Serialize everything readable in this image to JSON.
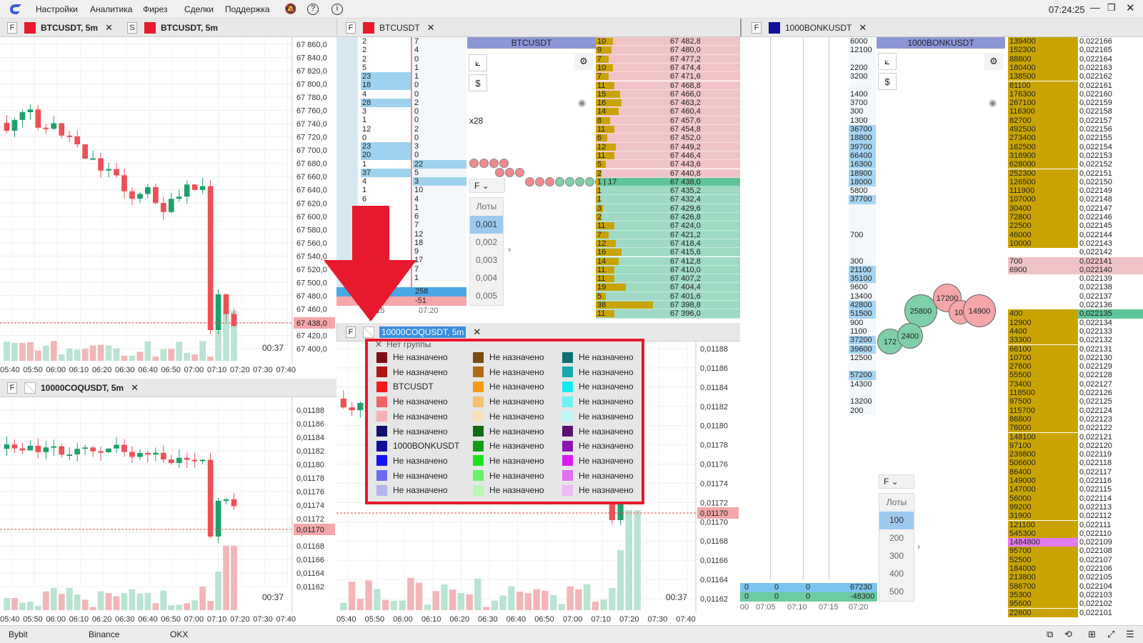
{
  "menu": {
    "items": [
      "Настройки",
      "Аналитика",
      "Фирез",
      "Сделки",
      "Поддержка"
    ],
    "clock": "07:24:25"
  },
  "chart1": {
    "tabs": [
      {
        "prefix": "F",
        "name": "BTCUSDT, 5m",
        "color": "#e8192c"
      },
      {
        "prefix": "S",
        "name": "BTCUSDT, 5m",
        "color": "#e8192c"
      }
    ],
    "y_ticks": [
      "67 860,0",
      "67 840,0",
      "67 820,0",
      "67 800,0",
      "67 780,0",
      "67 760,0",
      "67 740,0",
      "67 720,0",
      "67 700,0",
      "67 680,0",
      "67 660,0",
      "67 640,0",
      "67 620,0",
      "67 600,0",
      "67 580,0",
      "67 560,0",
      "67 540,0",
      "67 520,0",
      "67 500,0",
      "67 480,0",
      "67 460,0",
      "67 440,0",
      "67 420,0",
      "67 400,0"
    ],
    "x_ticks": [
      "05:40",
      "05:50",
      "06:00",
      "06:10",
      "06:20",
      "06:30",
      "06:40",
      "06:50",
      "07:00",
      "07:10",
      "07:20",
      "07:30",
      "07:40"
    ],
    "price_label": "67 438,0",
    "timer": "00:37"
  },
  "chart2": {
    "tab": {
      "prefix": "F",
      "name": "10000COQUSDT, 5m"
    },
    "y_ticks": [
      "0,01188",
      "0,01186",
      "0,01184",
      "0,01182",
      "0,01180",
      "0,01178",
      "0,01176",
      "0,01174",
      "0,01172",
      "0,01170",
      "0,01168",
      "0,01166",
      "0,01164",
      "0,01162"
    ],
    "x_ticks": [
      "05:40",
      "05:50",
      "06:00",
      "06:10",
      "06:20",
      "06:30",
      "06:40",
      "06:50",
      "07:00",
      "07:10",
      "07:20",
      "07:30",
      "07:40"
    ],
    "price_label": "0,01170",
    "timer": "00:37"
  },
  "btc_book": {
    "tab": {
      "prefix": "F",
      "name": "BTCUSDT",
      "color": "#e8192c"
    },
    "header": "BTCUSDT",
    "multiplier": "x28",
    "col1": [
      "2",
      "2",
      "2",
      "5",
      "23",
      "18",
      "4",
      "28",
      "3",
      "1",
      "12",
      "0",
      "23",
      "20",
      "1",
      "37",
      "4",
      "1",
      "6"
    ],
    "col2": [
      "7",
      "4",
      "0",
      "1",
      "1",
      "0",
      "0",
      "2",
      "0",
      "0",
      "2",
      "0",
      "3",
      "0",
      "22",
      "5",
      "3",
      "10",
      "4",
      "1",
      "6",
      "7",
      "12",
      "18",
      "9",
      "17",
      "7",
      "1"
    ],
    "sum_buy": "258",
    "sum_sell": "-51",
    "times": [
      "07:15",
      "07:20"
    ],
    "mode_select": "F",
    "lots_header": "Лоты",
    "lots": [
      "0,001",
      "0,002",
      "0,003",
      "0,004",
      "0,005"
    ],
    "prices": [
      "67 482,8",
      "67 480,0",
      "67 477,2",
      "67 474,4",
      "67 471,6",
      "67 468,8",
      "67 466,0",
      "67 463,2",
      "67 460,4",
      "67 457,6",
      "67 454,8",
      "67 452,0",
      "67 449,2",
      "67 446,4",
      "67 443,6",
      "67 440,8",
      "67 438,0",
      "67 435,2",
      "67 432,4",
      "67 429,6",
      "67 426,8",
      "67 424,0",
      "67 421,2",
      "67 418,4",
      "67 415,6",
      "67 412,8",
      "67 410,0",
      "67 407,2",
      "67 404,4",
      "67 401,6",
      "67 398,8",
      "67 396,0"
    ],
    "volumes": [
      "10",
      "9",
      "7",
      "10",
      "7",
      "11",
      "15",
      "16",
      "14",
      "8",
      "11",
      "6",
      "12",
      "11",
      "5",
      "2",
      "1 | 17",
      "1",
      "1",
      "3",
      "2",
      "11",
      "7",
      "12",
      "16",
      "14",
      "11",
      "11",
      "19",
      "5",
      "38",
      "11"
    ],
    "ask_count": 16
  },
  "coq_legend": {
    "tab": {
      "prefix": "F",
      "name": "10000COQUSDT, 5m"
    },
    "header": "Нет группы",
    "columns": [
      [
        {
          "color": "#7a0f14",
          "label": "Не назначено"
        },
        {
          "color": "#b01616",
          "label": "Не назначено"
        },
        {
          "color": "#f01c1c",
          "label": "BTCUSDT"
        },
        {
          "color": "#f26464",
          "label": "Не назначено"
        },
        {
          "color": "#f4b0b4",
          "label": "Не назначено"
        },
        {
          "color": "#101070",
          "label": "Не назначено"
        },
        {
          "color": "#10109a",
          "label": "1000BONKUSDT"
        },
        {
          "color": "#1414f0",
          "label": "Не назначено"
        },
        {
          "color": "#6b6bf0",
          "label": "Не назначено"
        },
        {
          "color": "#b4b4f0",
          "label": "Не назначено"
        }
      ],
      [
        {
          "color": "#7a4a10",
          "label": "Не назначено"
        },
        {
          "color": "#b06a16",
          "label": "Не назначено"
        },
        {
          "color": "#f59a18",
          "label": "Не назначено"
        },
        {
          "color": "#f6c070",
          "label": "Не назначено"
        },
        {
          "color": "#f8e0b8",
          "label": "Не назначено"
        },
        {
          "color": "#0f6a14",
          "label": "Не назначено"
        },
        {
          "color": "#119c18",
          "label": "Не назначено"
        },
        {
          "color": "#1ce41c",
          "label": "Не назначено"
        },
        {
          "color": "#6cf06c",
          "label": "Не назначено"
        },
        {
          "color": "#b8f6b8",
          "label": "Не назначено"
        }
      ],
      [
        {
          "color": "#0f6e74",
          "label": "Не назначено"
        },
        {
          "color": "#16a8b0",
          "label": "Не назначено"
        },
        {
          "color": "#16eaf0",
          "label": "Не назначено"
        },
        {
          "color": "#6ef0f4",
          "label": "Не назначено"
        },
        {
          "color": "#b8f6f8",
          "label": "Не назначено"
        },
        {
          "color": "#5c0f74",
          "label": "Не назначено"
        },
        {
          "color": "#8c14b0",
          "label": "Не назначено"
        },
        {
          "color": "#d81cf0",
          "label": "Не назначено"
        },
        {
          "color": "#e070f0",
          "label": "Не назначено"
        },
        {
          "color": "#eebaf6",
          "label": "Не назначено"
        }
      ]
    ],
    "y_ticks": [
      "0,01188",
      "0,01186",
      "0,01184",
      "0,01182",
      "0,01180",
      "0,01178",
      "0,01176",
      "0,01174",
      "0,01172",
      "0,01170",
      "0,01168",
      "0,01166",
      "0,01164",
      "0,01162"
    ],
    "x_ticks": [
      "05:40",
      "05:50",
      "06:00",
      "06:10",
      "06:20",
      "06:30",
      "06:40",
      "06:50",
      "07:00",
      "07:10",
      "07:20",
      "07:30",
      "07:40"
    ],
    "price_label": "0,01170",
    "timer": "00:37"
  },
  "bonk_book": {
    "tab": {
      "prefix": "F",
      "name": "1000BONKUSDT",
      "color": "#10109a"
    },
    "header": "1000BONKUSDT",
    "left_vols": [
      "6000",
      "12100",
      "",
      "2200",
      "3200",
      "",
      "1400",
      "3700",
      "300",
      "1300",
      "36700",
      "18800",
      "39700",
      "66400",
      "16300",
      "18900",
      "18000",
      "5800",
      "37700",
      "",
      "",
      "",
      "700",
      "",
      "",
      "300",
      "21100",
      "35100",
      "9600",
      "13400",
      "42800",
      "51500",
      "900",
      "1100",
      "37200",
      "39600",
      "12500",
      "",
      "57200",
      "14300",
      "",
      "13200",
      "200"
    ],
    "bubbles": [
      "25800",
      "17200",
      "100",
      "14900",
      "172",
      "2400"
    ],
    "mode_select": "F",
    "lots_header": "Лоты",
    "lots": [
      "100",
      "200",
      "300",
      "400",
      "500"
    ],
    "sizes": [
      "139400",
      "152300",
      "88800",
      "180400",
      "138500",
      "81100",
      "176300",
      "267100",
      "116300",
      "82700",
      "492500",
      "273400",
      "162500",
      "318900",
      "628000",
      "252300",
      "126500",
      "111900",
      "107000",
      "30400",
      "72800",
      "22500",
      "46000",
      "10000",
      "",
      "700",
      "6900",
      "",
      "",
      "",
      "",
      "400",
      "12900",
      "4400",
      "33300",
      "66100",
      "10700",
      "27600",
      "55500",
      "73400",
      "118500",
      "97500",
      "115700",
      "86800",
      "76000",
      "148100",
      "97100",
      "239800",
      "506600",
      "86400",
      "149000",
      "147000",
      "56000",
      "99200",
      "31900",
      "121100",
      "545300",
      "1484800",
      "95700",
      "52500",
      "184000",
      "213800",
      "586700",
      "35300",
      "95600",
      "22600"
    ],
    "prices": [
      "0,022166",
      "0,022165",
      "0,022164",
      "0,022163",
      "0,022162",
      "0,022161",
      "0,022160",
      "0,022159",
      "0,022158",
      "0,022157",
      "0,022156",
      "0,022155",
      "0,022154",
      "0,022153",
      "0,022152",
      "0,022151",
      "0,022150",
      "0,022149",
      "0,022148",
      "0,022147",
      "0,022146",
      "0,022145",
      "0,022144",
      "0,022143",
      "0,022142",
      "0,022141",
      "0,022140",
      "0,022139",
      "0,022138",
      "0,022137",
      "0,022136",
      "0,022135",
      "0,022134",
      "0,022133",
      "0,022132",
      "0,022131",
      "0,022130",
      "0,022129",
      "0,022128",
      "0,022127",
      "0,022126",
      "0,022125",
      "0,022124",
      "0,022123",
      "0,022122",
      "0,022121",
      "0,022120",
      "0,022119",
      "0,022118",
      "0,022117",
      "0,022116",
      "0,022115",
      "0,022114",
      "0,022113",
      "0,022112",
      "0,022111",
      "0,022110",
      "0,022109",
      "0,022108",
      "0,022107",
      "0,022106",
      "0,022105",
      "0,022104",
      "0,022103",
      "0,022102",
      "0,022101"
    ],
    "trade_rows": [
      [
        "0",
        "0",
        "0",
        "67230"
      ],
      [
        "0",
        "0",
        "0",
        "-48300"
      ]
    ],
    "times": [
      "00",
      "07:05",
      "07:10",
      "07:15",
      "07:20"
    ]
  },
  "exchanges": [
    "Bybit",
    "Binance",
    "OKX"
  ],
  "colors": {
    "bull": "#1fa06a",
    "bear": "#ef4f57",
    "accent_red": "#e8192c",
    "ask_bg": "#f0c4c6",
    "bid_bg": "#9fd9c3",
    "gold": "#c9a400",
    "sel_blue": "#9ec9ef"
  }
}
